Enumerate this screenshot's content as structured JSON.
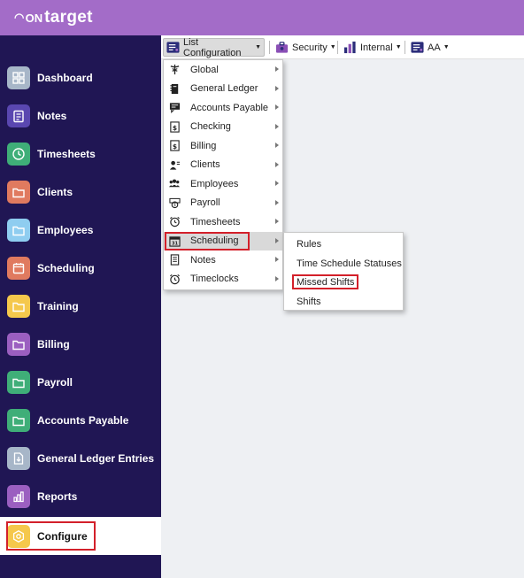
{
  "app": {
    "logo_prefix": "ON",
    "logo_main": "target",
    "brand_color": "#a36cc8",
    "sidebar_color": "#201654"
  },
  "sidebar": {
    "items": [
      {
        "label": "Dashboard",
        "icon": "dashboard-grid-icon",
        "color": "#a7b6c8"
      },
      {
        "label": "Notes",
        "icon": "notes-icon",
        "color": "#5a47b0"
      },
      {
        "label": "Timesheets",
        "icon": "clock-icon",
        "color": "#3fae78"
      },
      {
        "label": "Clients",
        "icon": "folder-icon",
        "color": "#e07a5f"
      },
      {
        "label": "Employees",
        "icon": "folder-icon",
        "color": "#8fcdf0"
      },
      {
        "label": "Scheduling",
        "icon": "calendar-icon",
        "color": "#e07a5f"
      },
      {
        "label": "Training",
        "icon": "folder-icon",
        "color": "#f5c84c"
      },
      {
        "label": "Billing",
        "icon": "folder-icon",
        "color": "#9b5fc0"
      },
      {
        "label": "Payroll",
        "icon": "folder-icon",
        "color": "#3fae78"
      },
      {
        "label": "Accounts Payable",
        "icon": "folder-icon",
        "color": "#3fae78"
      },
      {
        "label": "General Ledger Entries",
        "icon": "document-download-icon",
        "color": "#a7b6c8"
      },
      {
        "label": "Reports",
        "icon": "bar-chart-icon",
        "color": "#9b5fc0"
      },
      {
        "label": "Configure",
        "icon": "hexagon-gear-icon",
        "color": "#f5c84c"
      }
    ]
  },
  "toolbar": {
    "list_configuration": "List Configuration",
    "security": "Security",
    "internal": "Internal",
    "aa": "AA"
  },
  "list_menu": {
    "items": [
      {
        "label": "Global",
        "icon": "caduceus-icon"
      },
      {
        "label": "General Ledger",
        "icon": "ledger-book-icon"
      },
      {
        "label": "Accounts Payable",
        "icon": "invoice-icon"
      },
      {
        "label": "Checking",
        "icon": "dollar-doc-icon"
      },
      {
        "label": "Billing",
        "icon": "dollar-doc-icon"
      },
      {
        "label": "Clients",
        "icon": "person-list-icon"
      },
      {
        "label": "Employees",
        "icon": "people-group-icon"
      },
      {
        "label": "Payroll",
        "icon": "payroll-badge-icon"
      },
      {
        "label": "Timesheets",
        "icon": "alarm-clock-icon"
      },
      {
        "label": "Scheduling",
        "icon": "calendar-icon"
      },
      {
        "label": "Notes",
        "icon": "notepad-icon"
      },
      {
        "label": "Timeclocks",
        "icon": "alarm-clock-icon"
      }
    ]
  },
  "scheduling_submenu": {
    "items": [
      {
        "label": "Rules"
      },
      {
        "label": "Time Schedule Statuses"
      },
      {
        "label": "Missed Shifts"
      },
      {
        "label": "Shifts"
      }
    ]
  },
  "highlight_color": "#d3202a"
}
